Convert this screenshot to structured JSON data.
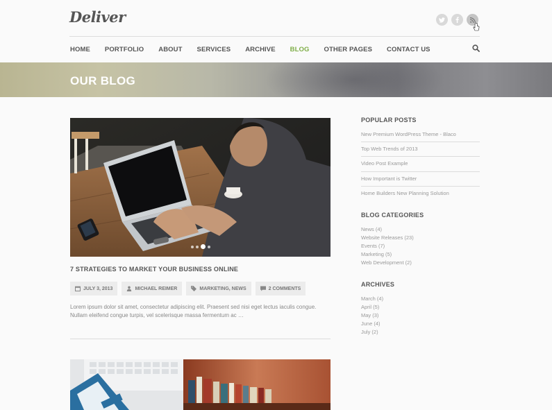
{
  "brand": {
    "logo": "Deliver"
  },
  "social": [
    "twitter-icon",
    "facebook-icon",
    "rss-icon"
  ],
  "nav": {
    "items": [
      "HOME",
      "PORTFOLIO",
      "ABOUT",
      "SERVICES",
      "ARCHIVE",
      "BLOG",
      "OTHER PAGES",
      "CONTACT US"
    ],
    "active": "BLOG"
  },
  "banner": {
    "title": "OUR BLOG"
  },
  "post": {
    "title": "7 STRATEGIES TO MARKET YOUR BUSINESS ONLINE",
    "date": "JULY 3, 2013",
    "author": "MICHAEL REIMER",
    "categories": "MARKETING, NEWS",
    "comments": "2 COMMENTS",
    "excerpt": "Lorem ipsum dolor sit amet, consectetur adipiscing elit. Praesent sed nisi eget lectus iaculis congue. Nullam eleifend congue turpis, vel scelerisque massa fermentum ac …"
  },
  "sidebar": {
    "popular": {
      "heading": "POPULAR POSTS",
      "items": [
        "New Premium WordPress Theme - Blaco",
        "Top Web Trends of 2013",
        "Video Post Example",
        "How Important is Twitter",
        "Home Builders New Planning Solution"
      ]
    },
    "categories": {
      "heading": "BLOG CATEGORIES",
      "items": [
        "News (4)",
        "Website Releases (23)",
        "Events (7)",
        "Marketing (5)",
        "Web Development (2)"
      ]
    },
    "archives": {
      "heading": "ARCHIVES",
      "items": [
        "March (4)",
        "April (5)",
        "May (3)",
        "June (4)",
        "July (2)"
      ]
    }
  },
  "colors": {
    "accent": "#7fae48",
    "text": "#555555",
    "muted": "#999999"
  }
}
